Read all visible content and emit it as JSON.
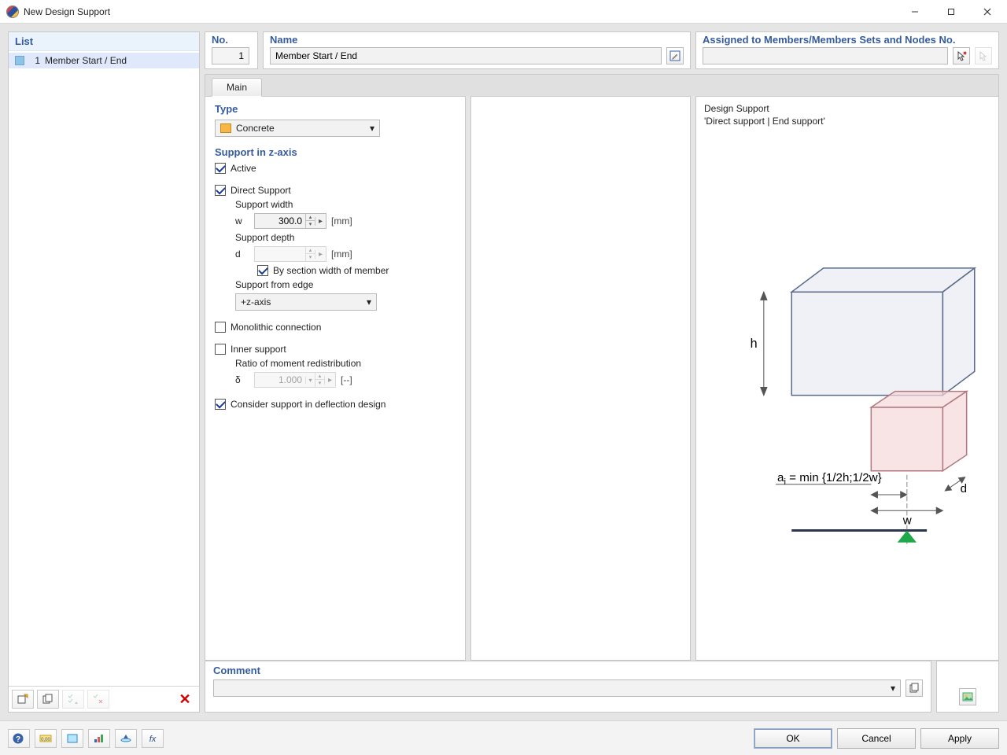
{
  "window": {
    "title": "New Design Support"
  },
  "left": {
    "header": "List",
    "item": {
      "num": "1",
      "text": "Member Start / End"
    }
  },
  "top": {
    "no_label": "No.",
    "no_value": "1",
    "name_label": "Name",
    "name_value": "Member Start / End",
    "assign_label": "Assigned to Members/Members Sets and Nodes No.",
    "assign_value": ""
  },
  "tabs": {
    "main": "Main"
  },
  "type": {
    "title": "Type",
    "value": "Concrete"
  },
  "support": {
    "title": "Support in z-axis",
    "active": "Active",
    "direct": "Direct Support",
    "width_lbl": "Support width",
    "w_sym": "w",
    "w_val": "300.0",
    "w_unit": "[mm]",
    "depth_lbl": "Support depth",
    "d_sym": "d",
    "d_unit": "[mm]",
    "by_section": "By section width of member",
    "edge_lbl": "Support from edge",
    "edge_val": "+z-axis",
    "mono": "Monolithic connection",
    "inner": "Inner support",
    "ratio_lbl": "Ratio of moment redistribution",
    "delta_sym": "δ",
    "delta_val": "1.000",
    "delta_unit": "[--]",
    "consider": "Consider support in deflection design"
  },
  "preview": {
    "title": "Design Support",
    "sub": "'Direct support | End support'",
    "formula_pre": "a",
    "formula_sub": "i",
    "formula_rest": " = min {1/2h;1/2w}",
    "h": "h",
    "w": "w",
    "d": "d"
  },
  "comment": {
    "title": "Comment",
    "value": ""
  },
  "buttons": {
    "ok": "OK",
    "cancel": "Cancel",
    "apply": "Apply"
  }
}
